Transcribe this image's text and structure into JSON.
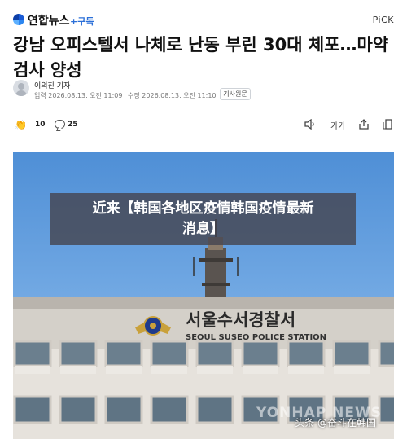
{
  "header": {
    "brand": "연합뉴스",
    "subscribe": "+구독",
    "pick": "PiCK"
  },
  "article": {
    "title": "강남 오피스텔서 나체로 난동 부린 30대 체포…마약검사 양성",
    "author": "이의진 기자",
    "published": "입력 2026.08.13. 오전 11:09",
    "updated": "수정 2026.08.13. 오전 11:10",
    "original_button": "기사원문"
  },
  "actions": {
    "reactions": "10",
    "comments": "25",
    "font_size_label": "가가"
  },
  "photo": {
    "building_sign": "서울수서경찰서",
    "building_sign_en": "SEOUL SUSEO POLICE STATION",
    "agency_watermark": "YONHAP NEWS",
    "source_watermark": "头条 @奋斗在韩国"
  },
  "banner": {
    "line1": "近来【韩国各地区疫情韩国疫情最新",
    "line2": "消息】"
  },
  "colors": {
    "accent": "#2b6fd8",
    "banner_bg": "#46464f",
    "sky": "#6ea6e2"
  }
}
